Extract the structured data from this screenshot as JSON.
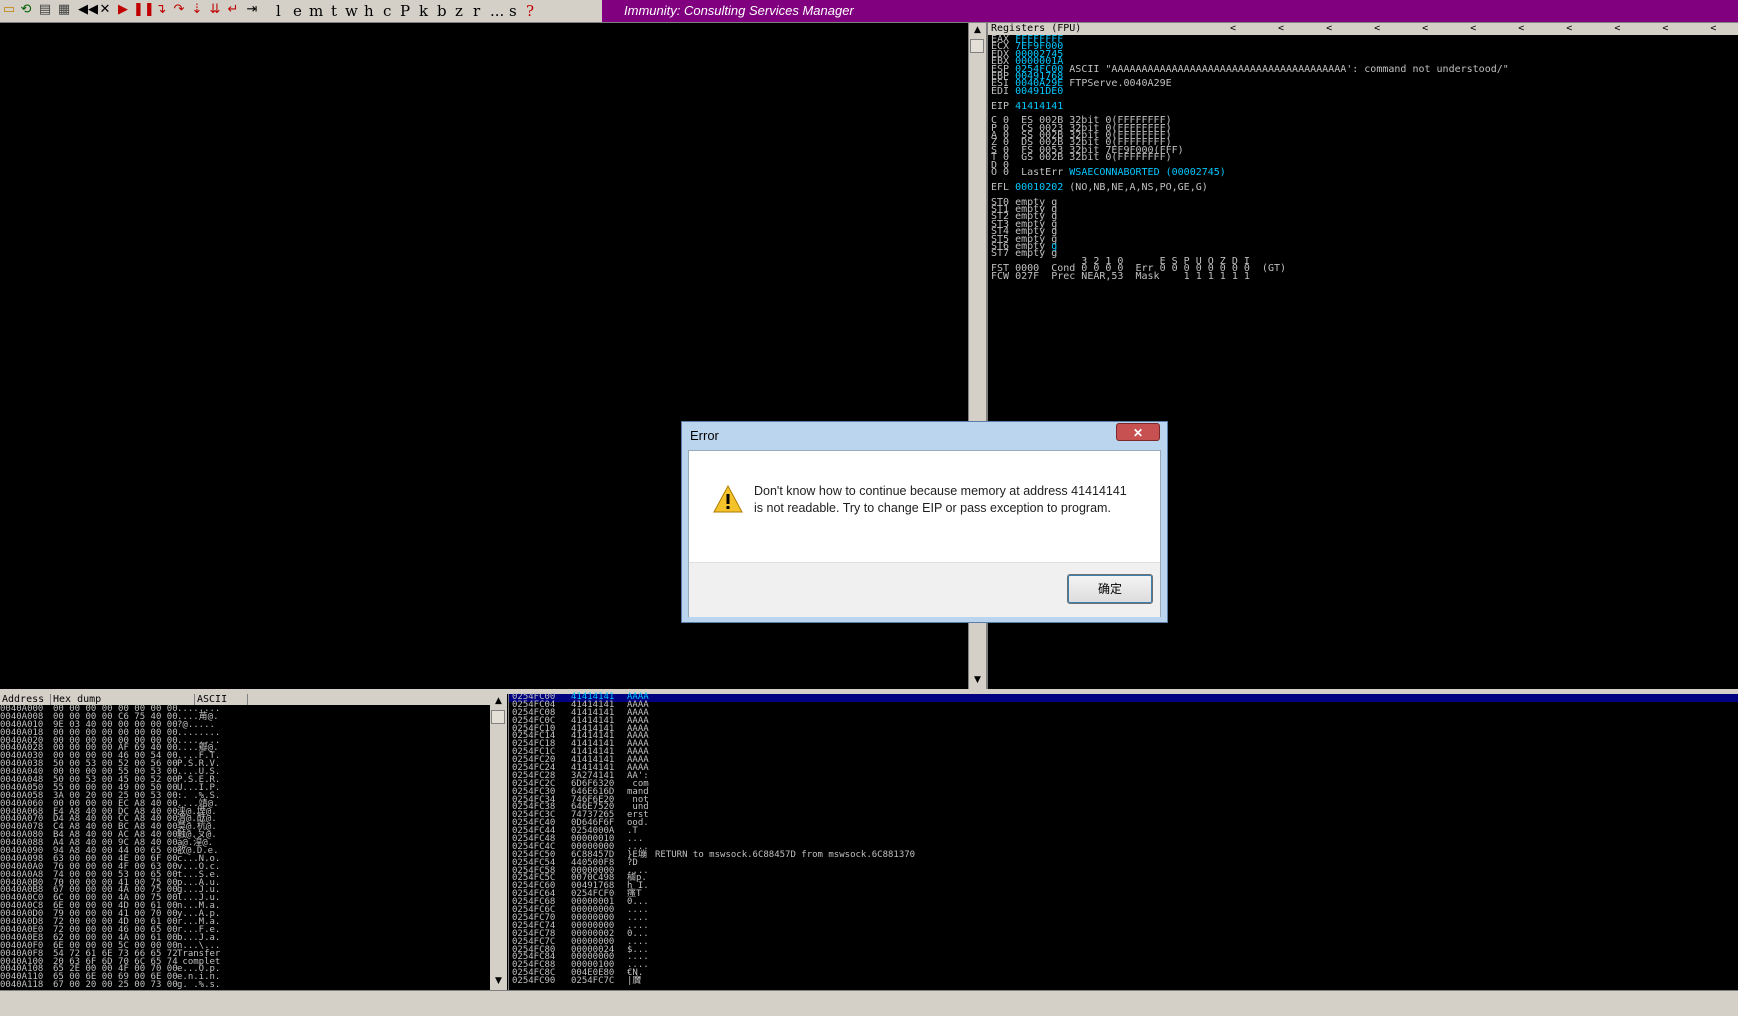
{
  "toolbar": {
    "letters": [
      "l",
      "e",
      "m",
      "t",
      "w",
      "h",
      "c",
      "P",
      "k",
      "b",
      "z",
      "r",
      "...",
      "s",
      "?"
    ],
    "window_title": "Immunity: Consulting Services Manager"
  },
  "registers": {
    "header": "Registers (FPU)",
    "arrows": "< < < < < < < < < < < < < < < < ",
    "lines": [
      [
        "EAX ",
        "FFFFFFFF",
        ""
      ],
      [
        "ECX ",
        "7EF9F000",
        ""
      ],
      [
        "EDX ",
        "00002745",
        ""
      ],
      [
        "EBX ",
        "0000001A",
        ""
      ],
      [
        "ESP ",
        "0254FC00",
        " ASCII \"AAAAAAAAAAAAAAAAAAAAAAAAAAAAAAAAAAAAAAA': command not understood/\""
      ],
      [
        "EBP ",
        "00491768",
        ""
      ],
      [
        "ESI ",
        "0040A29E",
        " FTPServe.0040A29E"
      ],
      [
        "EDI ",
        "00491DE0",
        ""
      ],
      [
        "",
        "",
        ""
      ],
      [
        "EIP ",
        "41414141",
        ""
      ],
      [
        "",
        "",
        ""
      ],
      [
        "C 0  ES 002B 32bit 0(FFFFFFFF)",
        "",
        ""
      ],
      [
        "P 0  CS 0023 32bit 0(FFFFFFFF)",
        "",
        ""
      ],
      [
        "A 0  SS 002B 32bit 0(FFFFFFFF)",
        "",
        ""
      ],
      [
        "Z 0  DS 002B 32bit 0(FFFFFFFF)",
        "",
        ""
      ],
      [
        "S 0  FS 0053 32bit 7EF9F000(FFF)",
        "",
        ""
      ],
      [
        "T 0  GS 002B 32bit 0(FFFFFFFF)",
        "",
        ""
      ],
      [
        "D 0",
        "",
        ""
      ],
      [
        "O 0  LastErr ",
        "WSAECONNABORTED (00002745)",
        ""
      ],
      [
        "",
        "",
        ""
      ],
      [
        "EFL ",
        "00010202",
        " (NO,NB,NE,A,NS,PO,GE,G)"
      ],
      [
        "",
        "",
        ""
      ],
      [
        "ST0 empty g",
        "",
        ""
      ],
      [
        "ST1 empty g",
        "",
        ""
      ],
      [
        "ST2 empty g",
        "",
        ""
      ],
      [
        "ST3 empty g",
        "",
        ""
      ],
      [
        "ST4 empty g",
        "",
        ""
      ],
      [
        "ST5 empty g",
        "",
        ""
      ],
      [
        "ST6 empty ",
        "g",
        ""
      ],
      [
        "ST7 empty g",
        "",
        ""
      ],
      [
        "               3 2 1 0      E S P U O Z D I",
        "",
        ""
      ],
      [
        "FST 0000  Cond 0 0 0 0  Err 0 0 0 0 0 0 0 0  (GT)",
        "",
        ""
      ],
      [
        "FCW 027F  Prec NEAR,53  Mask    1 1 1 1 1 1",
        "",
        ""
      ]
    ]
  },
  "dump": {
    "headers": [
      "Address",
      "Hex dump",
      "ASCII"
    ],
    "rows": [
      [
        "0040A000",
        "00 00 00 00 00 00 00 00",
        "........"
      ],
      [
        "0040A008",
        "00 00 00 00 C6 75 40 00",
        "....苚@."
      ],
      [
        "0040A010",
        "9E 03 40 00 00 00 00 00",
        "?@....."
      ],
      [
        "0040A018",
        "00 00 00 00 00 00 00 00",
        "........"
      ],
      [
        "0040A020",
        "00 00 00 00 00 00 00 00",
        "........"
      ],
      [
        "0040A028",
        "00 00 00 00 AF 69 40 00",
        "....瓣@."
      ],
      [
        "0040A030",
        "00 00 00 00 46 00 54 00",
        "....F.T."
      ],
      [
        "0040A038",
        "50 00 53 00 52 00 56 00",
        "P.S.R.V."
      ],
      [
        "0040A040",
        "00 00 00 00 55 00 53 00",
        "....U.S."
      ],
      [
        "0040A048",
        "50 00 53 00 45 00 52 00",
        "P.S.E.R."
      ],
      [
        "0040A050",
        "55 00 00 00 49 00 50 00",
        "U...I.P."
      ],
      [
        "0040A058",
        "3A 00 20 00 25 00 53 00",
        ":. .%.S."
      ],
      [
        "0040A060",
        "00 00 00 00 EC A8 40 00",
        "....靖@."
      ],
      [
        "0040A068",
        "E4 A8 40 00 DC A8 40 00",
        "浃@.堙@."
      ],
      [
        "0040A070",
        "D4 A8 40 00 CC A8 40 00",
        "渭@.酞@."
      ],
      [
        "0040A078",
        "C4 A8 40 00 BC A8 40 00",
        "莫@.杭@."
      ],
      [
        "0040A080",
        "B4 A8 40 00 AC A8 40 00",
        "触@.ㄆ@."
      ],
      [
        "0040A088",
        "A4 A8 40 00 9C A8 40 00",
        "à@.湟@."
      ],
      [
        "0040A090",
        "94 A8 40 00 44 00 65 00",
        "敋@.D.e."
      ],
      [
        "0040A098",
        "63 00 00 00 4E 00 6F 00",
        "c...N.o."
      ],
      [
        "0040A0A0",
        "76 00 00 00 4F 00 63 00",
        "v...O.c."
      ],
      [
        "0040A0A8",
        "74 00 00 00 53 00 65 00",
        "t...S.e."
      ],
      [
        "0040A0B0",
        "70 00 00 00 41 00 75 00",
        "p...A.u."
      ],
      [
        "0040A0B8",
        "67 00 00 00 4A 00 75 00",
        "g...J.u."
      ],
      [
        "0040A0C0",
        "6C 00 00 00 4A 00 75 00",
        "l...J.u."
      ],
      [
        "0040A0C8",
        "6E 00 00 00 4D 00 61 00",
        "n...M.a."
      ],
      [
        "0040A0D0",
        "79 00 00 00 41 00 70 00",
        "y...A.p."
      ],
      [
        "0040A0D8",
        "72 00 00 00 4D 00 61 00",
        "r...M.a."
      ],
      [
        "0040A0E0",
        "72 00 00 00 46 00 65 00",
        "r...F.e."
      ],
      [
        "0040A0E8",
        "62 00 00 00 4A 00 61 00",
        "b...J.a."
      ],
      [
        "0040A0F0",
        "6E 00 00 00 5C 00 00 00",
        "n...\\..."
      ],
      [
        "0040A0F8",
        "54 72 61 6E 73 66 65 72",
        "Transfer"
      ],
      [
        "0040A100",
        "20 63 6F 6D 70 6C 65 74",
        " complet"
      ],
      [
        "0040A108",
        "65 2E 00 00 4F 00 70 00",
        "e...O.p."
      ],
      [
        "0040A110",
        "65 00 6E 00 69 00 6E 00",
        "e.n.i.n."
      ],
      [
        "0040A118",
        "67 00 20 00 25 00 73 00",
        "g. .%.s."
      ]
    ]
  },
  "stack": {
    "rows": [
      [
        "0254FC00",
        "41414141",
        "AAAA",
        ""
      ],
      [
        "0254FC04",
        "41414141",
        "AAAA",
        ""
      ],
      [
        "0254FC08",
        "41414141",
        "AAAA",
        ""
      ],
      [
        "0254FC0C",
        "41414141",
        "AAAA",
        ""
      ],
      [
        "0254FC10",
        "41414141",
        "AAAA",
        ""
      ],
      [
        "0254FC14",
        "41414141",
        "AAAA",
        ""
      ],
      [
        "0254FC18",
        "41414141",
        "AAAA",
        ""
      ],
      [
        "0254FC1C",
        "41414141",
        "AAAA",
        ""
      ],
      [
        "0254FC20",
        "41414141",
        "AAAA",
        ""
      ],
      [
        "0254FC24",
        "41414141",
        "AAAA",
        ""
      ],
      [
        "0254FC28",
        "3A274141",
        "AA':",
        ""
      ],
      [
        "0254FC2C",
        "6D6F6320",
        " com",
        ""
      ],
      [
        "0254FC30",
        "646E616D",
        "mand",
        ""
      ],
      [
        "0254FC34",
        "746F6E20",
        " not",
        ""
      ],
      [
        "0254FC38",
        "646E7520",
        " und",
        ""
      ],
      [
        "0254FC3C",
        "74737265",
        "erst",
        ""
      ],
      [
        "0254FC40",
        "0D646F6F",
        "ood.",
        ""
      ],
      [
        "0254FC44",
        "0254000A",
        ".T",
        ""
      ],
      [
        "0254FC48",
        "00000010",
        "...",
        ""
      ],
      [
        "0254FC4C",
        "00000000",
        "....",
        ""
      ],
      [
        "0254FC50",
        "6C88457D",
        "}E塴",
        "RETURN to mswsock.6C88457D from mswsock.6C881370"
      ],
      [
        "0254FC54",
        "440500F8",
        "?D",
        ""
      ],
      [
        "0254FC58",
        "00000000",
        "....",
        ""
      ],
      [
        "0254FC5C",
        "0070C498",
        "樐p.",
        ""
      ],
      [
        "0254FC60",
        "00491768",
        "h I.",
        ""
      ],
      [
        "0254FC64",
        "0254FCF0",
        "瘙T",
        ""
      ],
      [
        "0254FC68",
        "00000001",
        "0...",
        ""
      ],
      [
        "0254FC6C",
        "00000000",
        "....",
        ""
      ],
      [
        "0254FC70",
        "00000000",
        "....",
        ""
      ],
      [
        "0254FC74",
        "00000000",
        "....",
        ""
      ],
      [
        "0254FC78",
        "00000002",
        "0...",
        ""
      ],
      [
        "0254FC7C",
        "00000000",
        "....",
        ""
      ],
      [
        "0254FC80",
        "00000024",
        "$...",
        ""
      ],
      [
        "0254FC84",
        "00000000",
        "....",
        ""
      ],
      [
        "0254FC88",
        "00000100",
        "....",
        ""
      ],
      [
        "0254FC8C",
        "004E0E80",
        "€N.",
        ""
      ],
      [
        "0254FC90",
        "0254FC7C",
        "|黂",
        ""
      ]
    ]
  },
  "dialog": {
    "title": "Error",
    "close_label": "✕",
    "message": "Don't know how to continue because memory at address 41414141 is not readable. Try to change EIP or pass exception to program.",
    "ok_label": "确定"
  }
}
